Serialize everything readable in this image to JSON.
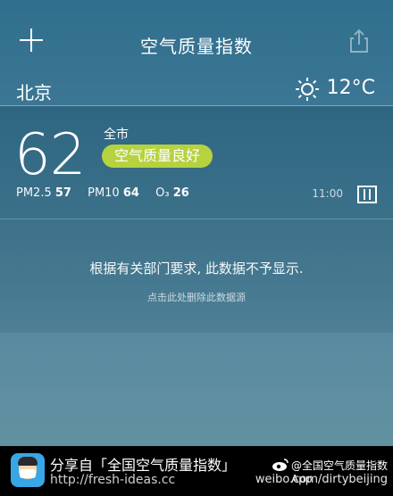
{
  "header": {
    "title": "空气质量指数"
  },
  "city": {
    "name": "北京",
    "weather_icon": "sun-icon",
    "temperature": "12°C"
  },
  "air": {
    "aqi": "62",
    "scope": "全市",
    "level": "空气质量良好",
    "level_color": "#b6d23f",
    "pollutants": [
      {
        "label": "PM2.5",
        "value": "57"
      },
      {
        "label": "PM10",
        "value": "64"
      },
      {
        "label": "O₃",
        "value": "26"
      }
    ],
    "time": "11:00"
  },
  "notice": {
    "text": "根据有关部门要求, 此数据不予显示.",
    "delete_link": "点击此处删除此数据源"
  },
  "footer": {
    "share_text": "分享自「全国空气质量指数」",
    "url": "http://fresh-ideas.cc",
    "weibo_text": "@全国空气质量指数App",
    "weibo_url": "weibo.com/dirtybeijing"
  }
}
